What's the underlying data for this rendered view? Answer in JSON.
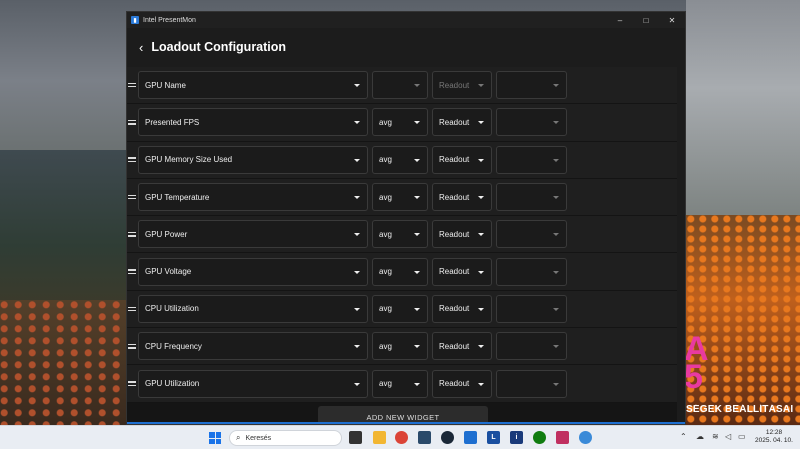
{
  "window": {
    "title": "Intel PresentMon",
    "controls": {
      "minimize": "–",
      "maximize": "□",
      "close": "✕"
    }
  },
  "header": {
    "back_glyph": "‹",
    "title": "Loadout Configuration"
  },
  "rows": [
    {
      "metric": "GPU Name",
      "stat": "",
      "widget": "Readout",
      "disabled": true
    },
    {
      "metric": "Presented FPS",
      "stat": "avg",
      "widget": "Readout",
      "disabled": false
    },
    {
      "metric": "GPU Memory Size Used",
      "stat": "avg",
      "widget": "Readout",
      "disabled": false
    },
    {
      "metric": "GPU Temperature",
      "stat": "avg",
      "widget": "Readout",
      "disabled": false
    },
    {
      "metric": "GPU Power",
      "stat": "avg",
      "widget": "Readout",
      "disabled": false
    },
    {
      "metric": "GPU Voltage",
      "stat": "avg",
      "widget": "Readout",
      "disabled": false
    },
    {
      "metric": "CPU Utilization",
      "stat": "avg",
      "widget": "Readout",
      "disabled": false
    },
    {
      "metric": "CPU Frequency",
      "stat": "avg",
      "widget": "Readout",
      "disabled": false
    },
    {
      "metric": "GPU Utilization",
      "stat": "avg",
      "widget": "Readout",
      "disabled": false
    }
  ],
  "add_widget_label": "ADD NEW WIDGET",
  "desktop": {
    "promo_letters": "A\n5",
    "promo_text": "SÉGEK BEÁLLÍTÁSAI"
  },
  "taskbar": {
    "search_placeholder": "Keresés",
    "time": "12:28",
    "date": "2025. 04. 10.",
    "icons": [
      "task-view",
      "file-explorer",
      "chrome",
      "steam-like",
      "steam",
      "presentmon",
      "launcher-l",
      "info",
      "xbox",
      "game",
      "browser"
    ]
  },
  "colors": {
    "accent": "#1e6fd0",
    "window_bg": "#1c1c1c",
    "promo": "#e83aa0"
  }
}
